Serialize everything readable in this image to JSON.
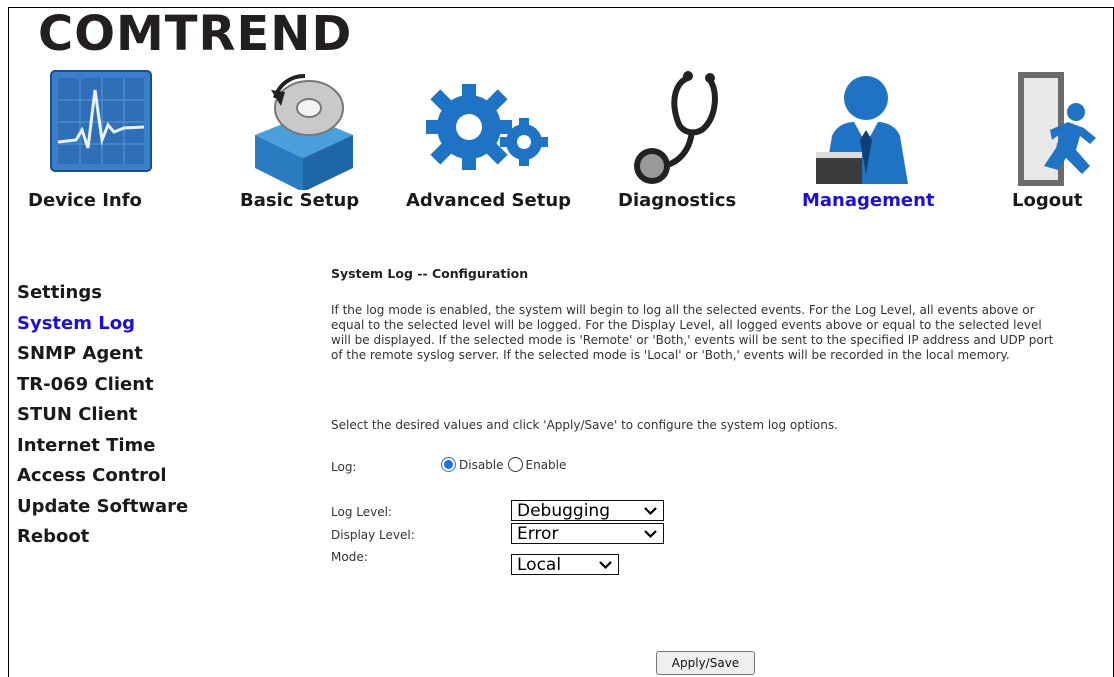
{
  "brand": {
    "logo_text": "COMTREND"
  },
  "nav": {
    "items": [
      {
        "label": "Device Info",
        "icon": "device-info-icon",
        "active": false
      },
      {
        "label": "Basic Setup",
        "icon": "basic-setup-icon",
        "active": false
      },
      {
        "label": "Advanced Setup",
        "icon": "advanced-setup-icon",
        "active": false
      },
      {
        "label": "Diagnostics",
        "icon": "diagnostics-icon",
        "active": false
      },
      {
        "label": "Management",
        "icon": "management-icon",
        "active": true
      },
      {
        "label": "Logout",
        "icon": "logout-icon",
        "active": false
      }
    ]
  },
  "sidebar": {
    "items": [
      {
        "label": "Settings",
        "active": false
      },
      {
        "label": "System Log",
        "active": true
      },
      {
        "label": "SNMP Agent",
        "active": false
      },
      {
        "label": "TR-069 Client",
        "active": false
      },
      {
        "label": "STUN Client",
        "active": false
      },
      {
        "label": "Internet Time",
        "active": false
      },
      {
        "label": "Access Control",
        "active": false
      },
      {
        "label": "Update Software",
        "active": false
      },
      {
        "label": "Reboot",
        "active": false
      }
    ]
  },
  "main": {
    "title": "System Log -- Configuration",
    "description": "If the log mode is enabled, the system will begin to log all the selected events. For the Log Level, all events above or equal to the selected level will be logged. For the Display Level, all logged events above or equal to the selected level will be displayed. If the selected mode is 'Remote' or 'Both,' events will be sent to the specified IP address and UDP port of the remote syslog server. If the selected mode is 'Local' or 'Both,' events will be recorded in the local memory.",
    "instruction": "Select the desired values and click 'Apply/Save' to configure the system log options.",
    "log": {
      "label": "Log:",
      "disable_label": "Disable",
      "enable_label": "Enable",
      "selected": "Disable"
    },
    "log_level": {
      "label": "Log Level:",
      "value": "Debugging"
    },
    "display_level": {
      "label": "Display Level:",
      "value": "Error"
    },
    "mode": {
      "label": "Mode:",
      "value": "Local"
    },
    "apply_label": "Apply/Save"
  },
  "colors": {
    "active_link": "#1a0ee0",
    "text": "#1a1a1a",
    "radio_accent": "#1a73e8"
  }
}
